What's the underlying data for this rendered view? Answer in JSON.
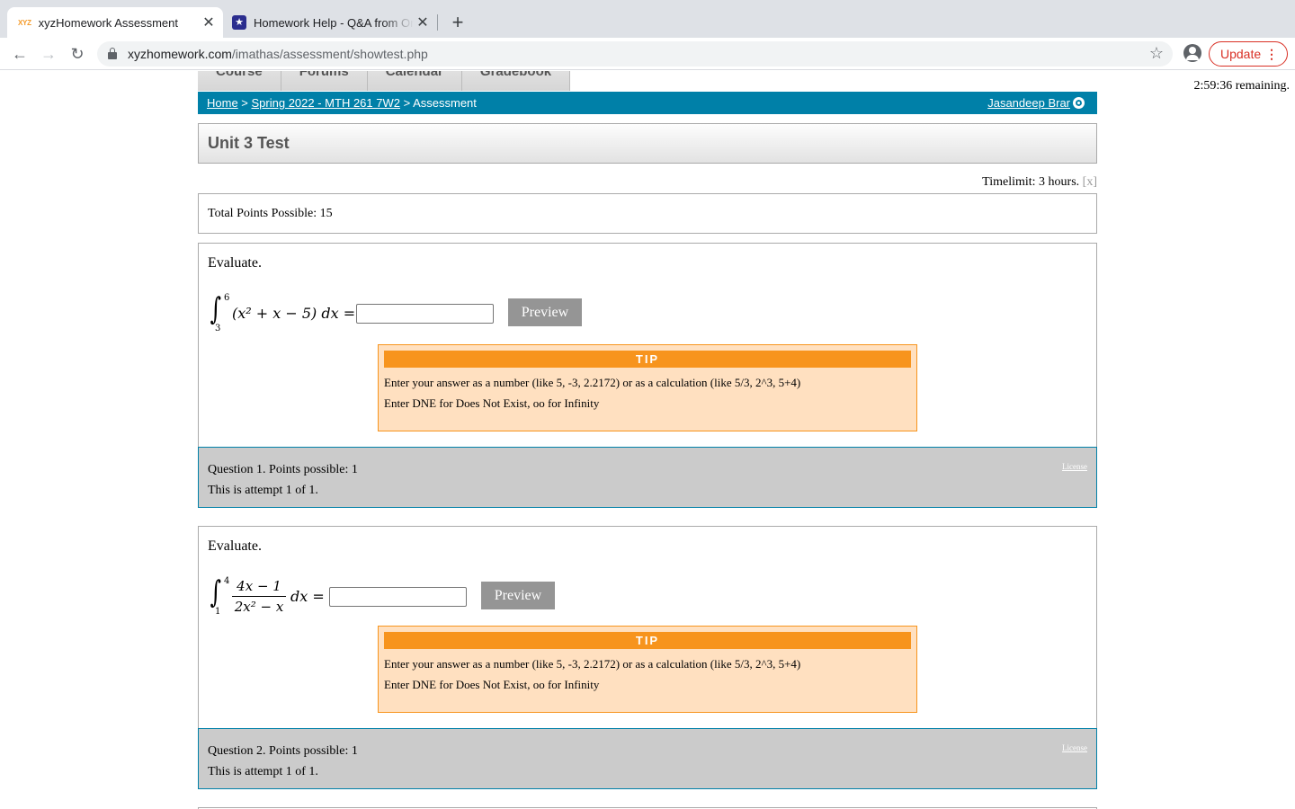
{
  "browser": {
    "tabs": [
      {
        "favicon": "xyz",
        "title": "xyzHomework Assessment",
        "active": true
      },
      {
        "favicon": "star",
        "title": "Homework Help - Q&A from Online Tutors",
        "active": false
      }
    ],
    "url_domain": "xyzhomework.com",
    "url_path": "/imathas/assessment/showtest.php",
    "update_label": "Update"
  },
  "page": {
    "timer": "2:59:36 remaining.",
    "nav_tabs": [
      "Course",
      "Forums",
      "Calendar",
      "Gradebook"
    ],
    "breadcrumb": {
      "home": "Home",
      "sep1": " > ",
      "course": "Spring 2022 - MTH 261 7W2",
      "sep2": " > ",
      "current": "Assessment"
    },
    "user_name": "Jasandeep Brar",
    "title": "Unit 3 Test",
    "timelimit": "Timelimit: 3 hours.",
    "timelimit_close": "[x]",
    "total_points": "Total Points Possible: 15"
  },
  "questions": [
    {
      "prompt": "Evaluate.",
      "lower": "3",
      "upper": "6",
      "integrand": "(x² + x − 5) dx =",
      "preview_label": "Preview",
      "tip_title": "TIP",
      "tip_line1": "Enter your answer as a number (like 5, -3, 2.2172) or as a calculation (like 5/3, 2^3, 5+4)",
      "tip_line2": "Enter DNE for Does Not Exist, oo for Infinity",
      "points": "Question 1. Points possible: 1",
      "attempt": "This is attempt 1 of 1.",
      "license": "License"
    },
    {
      "prompt": "Evaluate.",
      "lower": "1",
      "upper": "4",
      "numerator": "4x − 1",
      "denominator": "2x² − x",
      "tail": "dx =",
      "preview_label": "Preview",
      "tip_title": "TIP",
      "tip_line1": "Enter your answer as a number (like 5, -3, 2.2172) or as a calculation (like 5/3, 2^3, 5+4)",
      "tip_line2": "Enter DNE for Does Not Exist, oo for Infinity",
      "points": "Question 2. Points possible: 1",
      "attempt": "This is attempt 1 of 1.",
      "license": "License"
    }
  ]
}
